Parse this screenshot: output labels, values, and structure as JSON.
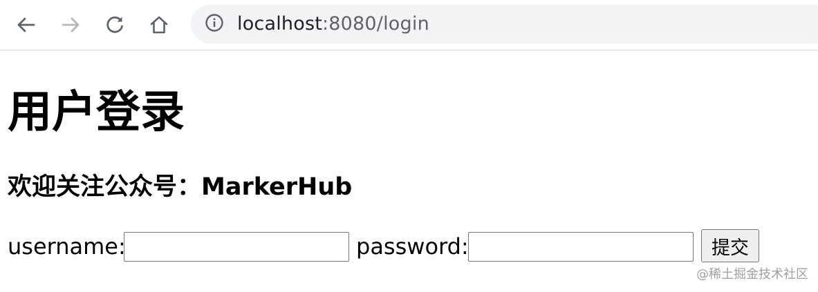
{
  "browser": {
    "url_host": "localhost",
    "url_rest": ":8080/login",
    "icons": {
      "back": "arrow-left-icon",
      "forward": "arrow-right-icon",
      "reload": "reload-icon",
      "home": "home-icon",
      "site_info": "info-icon"
    }
  },
  "page": {
    "title": "用户登录",
    "subtitle": "欢迎关注公众号：MarkerHub",
    "form": {
      "username_label": "username:",
      "username_value": "",
      "password_label": "password:",
      "password_value": "",
      "submit_label": "提交"
    }
  },
  "watermark": "@稀土掘金技术社区"
}
